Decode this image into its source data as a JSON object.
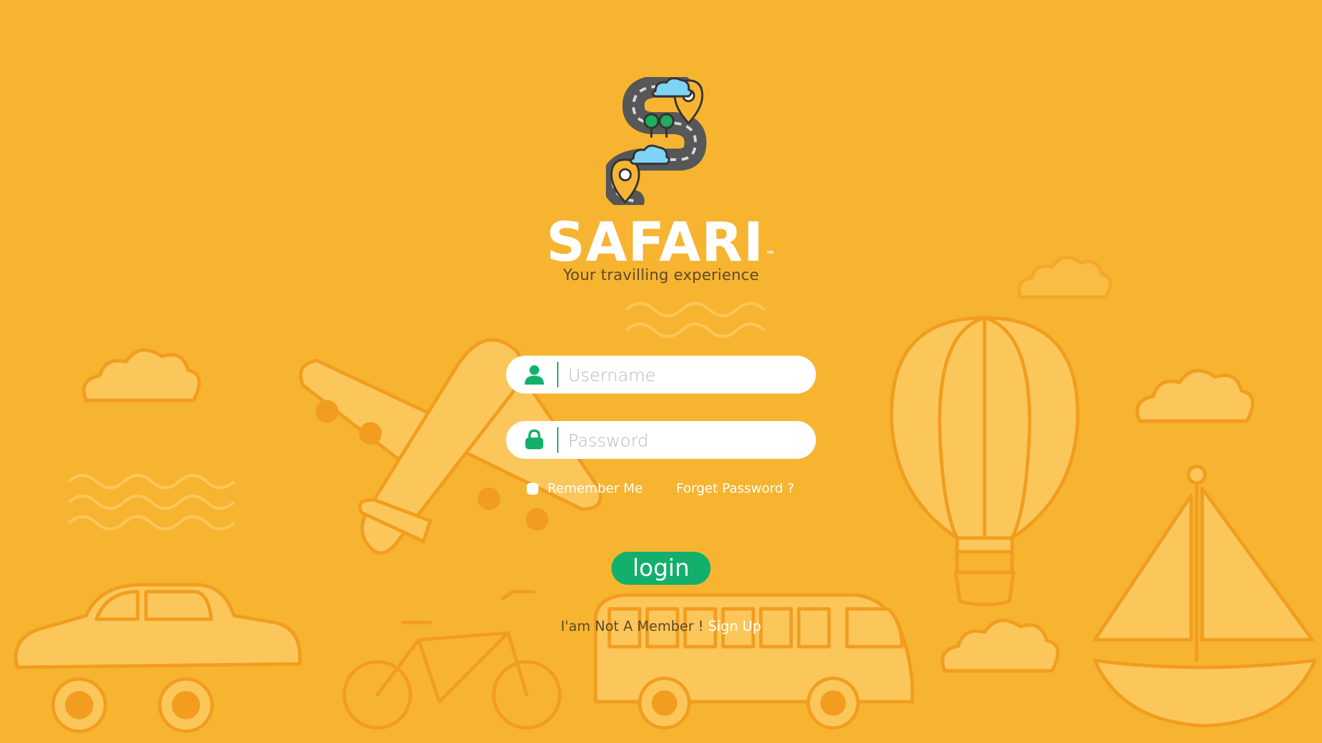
{
  "brand": {
    "name": "SAFARI",
    "trademark": "™",
    "tagline": "Your travilling experience"
  },
  "form": {
    "username": {
      "placeholder": "Username",
      "value": ""
    },
    "password": {
      "placeholder": "Password",
      "value": ""
    },
    "remember_label": "Remember Me",
    "forgot_label": "Forget Password ?",
    "login_label": "login"
  },
  "signup": {
    "prompt": "I'am Not A Member ! ",
    "link": "Sign Up"
  },
  "colors": {
    "background": "#f7b431",
    "accent": "#13b06b",
    "illustration": "#fcc75a",
    "illustration_stroke": "#f29d1f"
  },
  "icons": {
    "username": "user-icon",
    "password": "lock-icon"
  }
}
